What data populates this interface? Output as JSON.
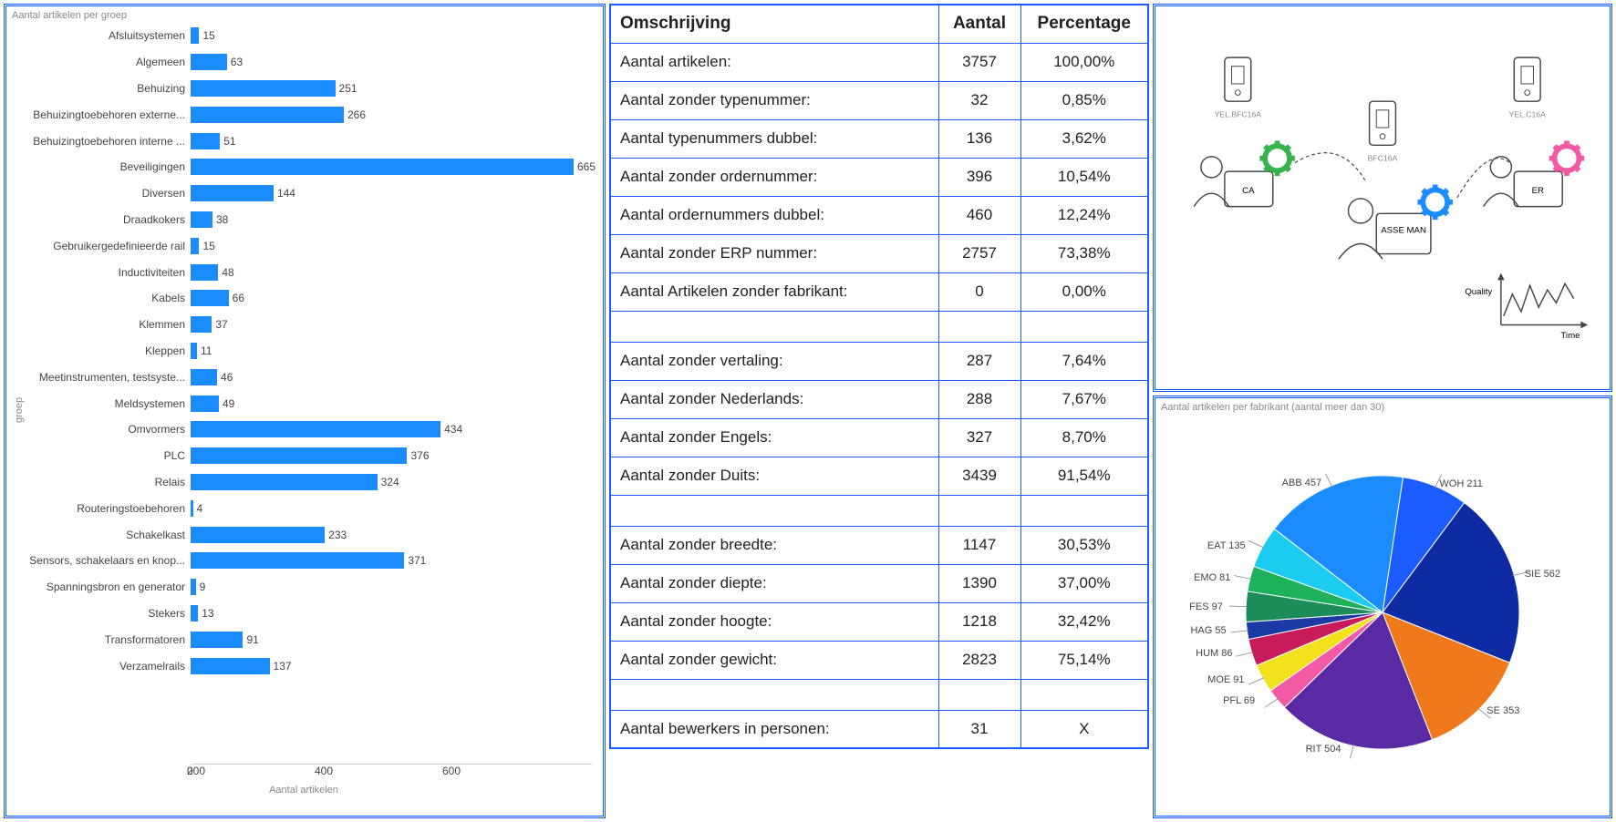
{
  "bar_chart": {
    "title": "Aantal artikelen per groep",
    "y_axis_label": "groep",
    "x_axis_label": "Aantal artikelen",
    "x_ticks": [
      "0",
      "200",
      "400",
      "600"
    ],
    "categories": [
      "Afsluitsystemen",
      "Algemeen",
      "Behuizing",
      "Behuizingtoebehoren externe...",
      "Behuizingtoebehoren interne ...",
      "Beveiligingen",
      "Diversen",
      "Draadkokers",
      "Gebruikergedefinieerde rail",
      "Inductiviteiten",
      "Kabels",
      "Klemmen",
      "Kleppen",
      "Meetinstrumenten, testsyste...",
      "Meldsystemen",
      "Omvormers",
      "PLC",
      "Relais",
      "Routeringstoebehoren",
      "Schakelkast",
      "Sensors, schakelaars en knop...",
      "Spanningsbron en generator",
      "Stekers",
      "Transformatoren",
      "Verzamelrails"
    ],
    "values": [
      15,
      63,
      251,
      266,
      51,
      665,
      144,
      38,
      15,
      48,
      66,
      37,
      11,
      46,
      49,
      434,
      376,
      324,
      4,
      233,
      371,
      9,
      13,
      91,
      137
    ]
  },
  "table": {
    "headers": {
      "desc": "Omschrijving",
      "count": "Aantal",
      "pct": "Percentage"
    },
    "rows": [
      {
        "desc": "Aantal artikelen:",
        "count": "3757",
        "pct": "100,00%"
      },
      {
        "desc": "Aantal zonder typenummer:",
        "count": "32",
        "pct": "0,85%"
      },
      {
        "desc": "Aantal typenummers dubbel:",
        "count": "136",
        "pct": "3,62%"
      },
      {
        "desc": "Aantal zonder ordernummer:",
        "count": "396",
        "pct": "10,54%"
      },
      {
        "desc": "Aantal ordernummers dubbel:",
        "count": "460",
        "pct": "12,24%"
      },
      {
        "desc": "Aantal zonder ERP nummer:",
        "count": "2757",
        "pct": "73,38%"
      },
      {
        "desc": "Aantal Artikelen zonder fabrikant:",
        "count": "0",
        "pct": "0,00%"
      },
      {
        "blank": true
      },
      {
        "desc": "Aantal zonder vertaling:",
        "count": "287",
        "pct": "7,64%"
      },
      {
        "desc": "Aantal zonder Nederlands:",
        "count": "288",
        "pct": "7,67%"
      },
      {
        "desc": "Aantal zonder Engels:",
        "count": "327",
        "pct": "8,70%"
      },
      {
        "desc": "Aantal zonder Duits:",
        "count": "3439",
        "pct": "91,54%"
      },
      {
        "blank": true
      },
      {
        "desc": "Aantal zonder breedte:",
        "count": "1147",
        "pct": "30,53%"
      },
      {
        "desc": "Aantal zonder diepte:",
        "count": "1390",
        "pct": "37,00%"
      },
      {
        "desc": "Aantal zonder hoogte:",
        "count": "1218",
        "pct": "32,42%"
      },
      {
        "desc": "Aantal zonder gewicht:",
        "count": "2823",
        "pct": "75,14%"
      },
      {
        "blank": true
      },
      {
        "desc": "Aantal bewerkers in personen:",
        "count": "31",
        "pct": "X"
      }
    ]
  },
  "illustration": {
    "labels": {
      "l1": "YEL.BFC16A",
      "l2": "BFC16A",
      "l3": "YEL.C16A",
      "screen1": "CA",
      "screen2": "ASSE MAN",
      "screen3": "ER",
      "quality": "Quality",
      "time": "Time"
    }
  },
  "pie_chart": {
    "title": "Aantal artikelen per fabrikant (aantal meer dan 30)",
    "slices": [
      {
        "label": "WOH 211",
        "value": 211,
        "color": "#1b5cff"
      },
      {
        "label": "SIE 562",
        "value": 562,
        "color": "#0f2aa5"
      },
      {
        "label": "SE 353",
        "value": 353,
        "color": "#f07a1b"
      },
      {
        "label": "RIT 504",
        "value": 504,
        "color": "#5a2aa5"
      },
      {
        "label": "PFL 69",
        "value": 69,
        "color": "#f25aa5"
      },
      {
        "label": "MOE 91",
        "value": 91,
        "color": "#f2e21b"
      },
      {
        "label": "HUM 86",
        "value": 86,
        "color": "#c71b5a"
      },
      {
        "label": "HAG 55",
        "value": 55,
        "color": "#1b3aa5"
      },
      {
        "label": "FES 97",
        "value": 97,
        "color": "#1b8c5a"
      },
      {
        "label": "EMO 81",
        "value": 81,
        "color": "#1bb25a"
      },
      {
        "label": "EAT 135",
        "value": 135,
        "color": "#1bccf0"
      },
      {
        "label": "ABB 457",
        "value": 457,
        "color": "#1b8cff"
      }
    ]
  },
  "chart_data": [
    {
      "type": "bar",
      "orientation": "horizontal",
      "title": "Aantal artikelen per groep",
      "xlabel": "Aantal artikelen",
      "ylabel": "groep",
      "xlim": [
        0,
        700
      ],
      "categories": [
        "Afsluitsystemen",
        "Algemeen",
        "Behuizing",
        "Behuizingtoebehoren externe...",
        "Behuizingtoebehoren interne ...",
        "Beveiligingen",
        "Diversen",
        "Draadkokers",
        "Gebruikergedefinieerde rail",
        "Inductiviteiten",
        "Kabels",
        "Klemmen",
        "Kleppen",
        "Meetinstrumenten, testsyste...",
        "Meldsystemen",
        "Omvormers",
        "PLC",
        "Relais",
        "Routeringstoebehoren",
        "Schakelkast",
        "Sensors, schakelaars en knop...",
        "Spanningsbron en generator",
        "Stekers",
        "Transformatoren",
        "Verzamelrails"
      ],
      "values": [
        15,
        63,
        251,
        266,
        51,
        665,
        144,
        38,
        15,
        48,
        66,
        37,
        11,
        46,
        49,
        434,
        376,
        324,
        4,
        233,
        371,
        9,
        13,
        91,
        137
      ]
    },
    {
      "type": "table",
      "title": "Omschrijving / Aantal / Percentage",
      "columns": [
        "Omschrijving",
        "Aantal",
        "Percentage"
      ],
      "rows": [
        [
          "Aantal artikelen:",
          3757,
          "100,00%"
        ],
        [
          "Aantal zonder typenummer:",
          32,
          "0,85%"
        ],
        [
          "Aantal typenummers dubbel:",
          136,
          "3,62%"
        ],
        [
          "Aantal zonder ordernummer:",
          396,
          "10,54%"
        ],
        [
          "Aantal ordernummers dubbel:",
          460,
          "12,24%"
        ],
        [
          "Aantal zonder ERP nummer:",
          2757,
          "73,38%"
        ],
        [
          "Aantal Artikelen zonder fabrikant:",
          0,
          "0,00%"
        ],
        [
          "Aantal zonder vertaling:",
          287,
          "7,64%"
        ],
        [
          "Aantal zonder Nederlands:",
          288,
          "7,67%"
        ],
        [
          "Aantal zonder Engels:",
          327,
          "8,70%"
        ],
        [
          "Aantal zonder Duits:",
          3439,
          "91,54%"
        ],
        [
          "Aantal zonder breedte:",
          1147,
          "30,53%"
        ],
        [
          "Aantal zonder diepte:",
          1390,
          "37,00%"
        ],
        [
          "Aantal zonder hoogte:",
          1218,
          "32,42%"
        ],
        [
          "Aantal zonder gewicht:",
          2823,
          "75,14%"
        ],
        [
          "Aantal bewerkers in personen:",
          31,
          "X"
        ]
      ]
    },
    {
      "type": "pie",
      "title": "Aantal artikelen per fabrikant (aantal meer dan 30)",
      "categories": [
        "WOH",
        "SIE",
        "SE",
        "RIT",
        "PFL",
        "MOE",
        "HUM",
        "HAG",
        "FES",
        "EMO",
        "EAT",
        "ABB"
      ],
      "values": [
        211,
        562,
        353,
        504,
        69,
        91,
        86,
        55,
        97,
        81,
        135,
        457
      ]
    }
  ]
}
